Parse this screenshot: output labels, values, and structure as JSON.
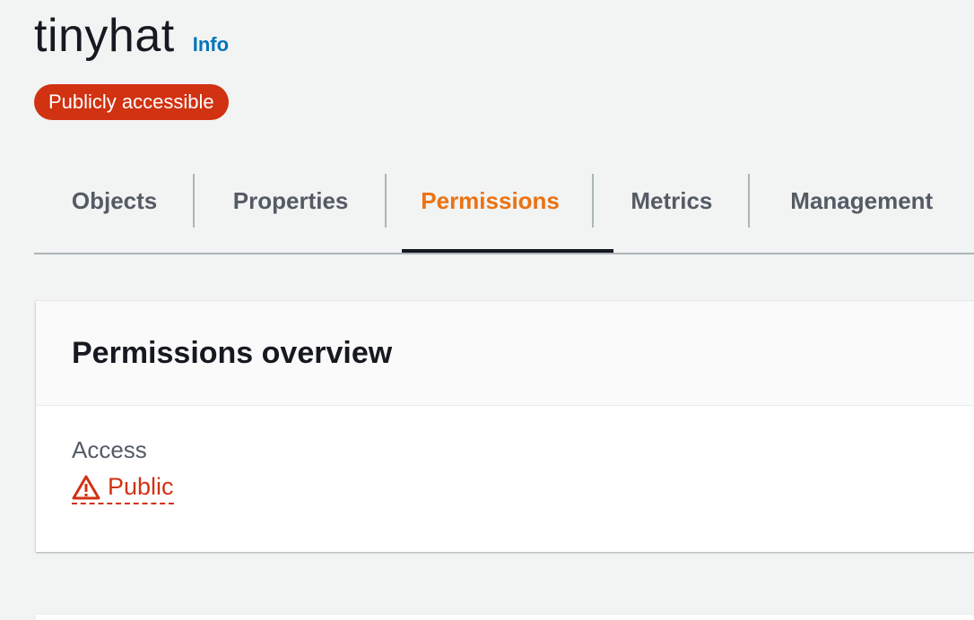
{
  "bucket": {
    "name": "tinyhat",
    "info_link": "Info",
    "status_badge": "Publicly accessible"
  },
  "tabs": [
    {
      "label": "Objects",
      "active": false
    },
    {
      "label": "Properties",
      "active": false
    },
    {
      "label": "Permissions",
      "active": true
    },
    {
      "label": "Metrics",
      "active": false
    },
    {
      "label": "Management",
      "active": false
    }
  ],
  "permissions_overview": {
    "title": "Permissions overview",
    "access_label": "Access",
    "access_value": "Public",
    "access_icon": "warning-icon"
  },
  "colors": {
    "accent": "#ec7211",
    "link": "#0073bb",
    "danger": "#d13212",
    "text": "#16191f"
  }
}
